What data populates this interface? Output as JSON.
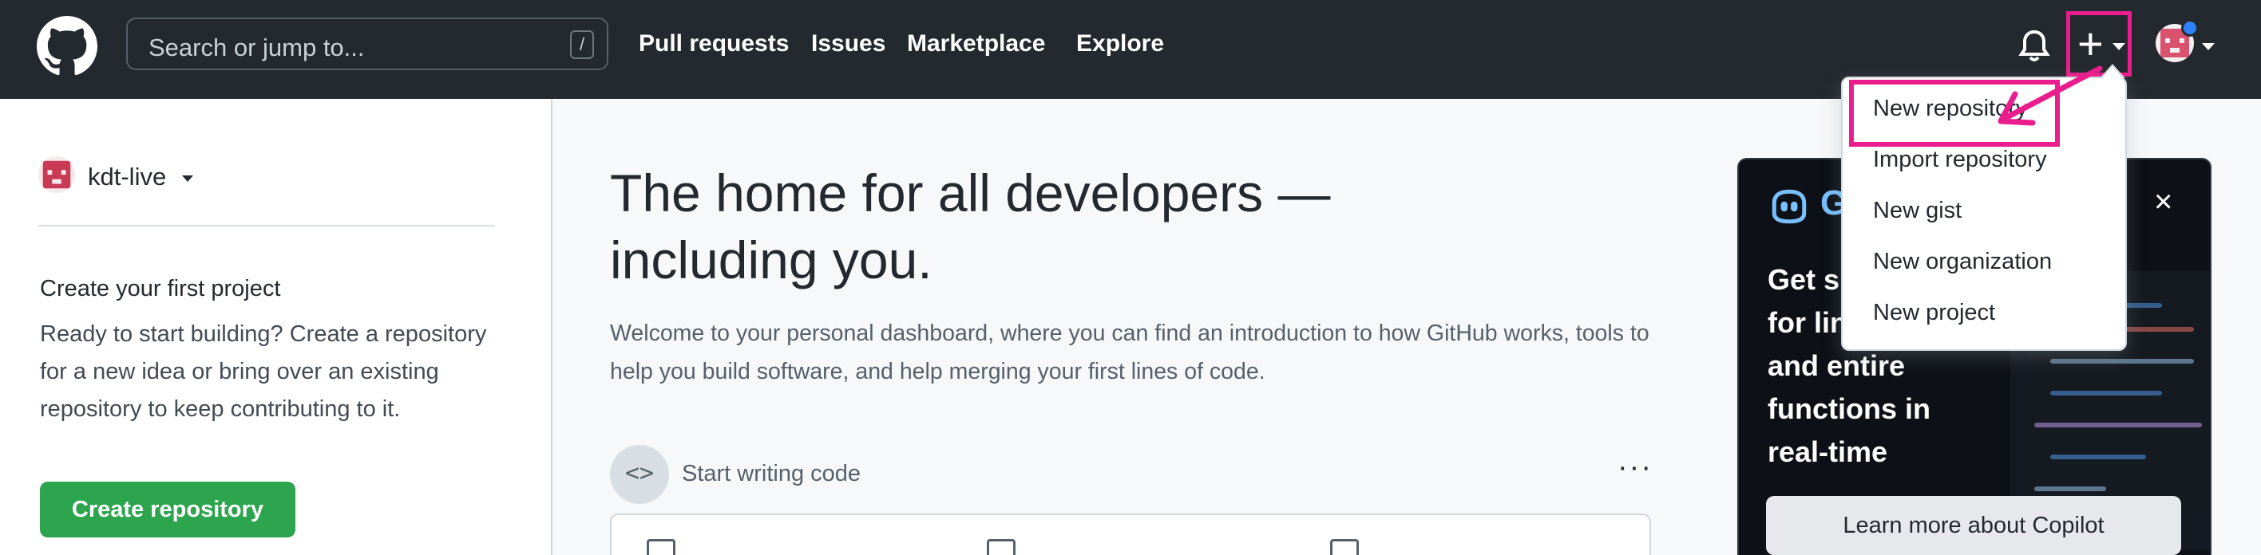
{
  "header": {
    "search_placeholder": "Search or jump to...",
    "search_shortcut": "/",
    "nav": [
      "Pull requests",
      "Issues",
      "Marketplace",
      "Explore"
    ],
    "plus_glyph": "+"
  },
  "sidebar": {
    "username": "kdt-live",
    "project_title": "Create your first project",
    "project_desc": "Ready to start building? Create a repository for a new idea or bring over an existing repository to keep contributing to it.",
    "create_button": "Create repository"
  },
  "main": {
    "hero_title": "The home for all developers — including you.",
    "hero_sub": "Welcome to your personal dashboard, where you can find an introduction to how GitHub works, tools to help you build software, and help merging your first lines of code.",
    "code_icon": "<>",
    "start_code": "Start writing code",
    "more_glyph": "···"
  },
  "dropdown": {
    "items": [
      "New repository",
      "Import repository",
      "New gist",
      "New organization",
      "New project"
    ]
  },
  "copilot": {
    "title_partial": "G",
    "close": "×",
    "headline": [
      "Get su",
      "for lin",
      "and entire",
      "functions in",
      "real-time"
    ],
    "button": "Learn more about Copilot"
  },
  "colors": {
    "header_bg": "#24292f",
    "accent_green": "#2da44e",
    "annotation_pink": "#e91e8c"
  },
  "icons": [
    "github-logo-icon",
    "bell-icon",
    "plus-icon",
    "chevron-down-icon",
    "code-icon",
    "kebab-icon",
    "copilot-icon",
    "close-icon"
  ]
}
